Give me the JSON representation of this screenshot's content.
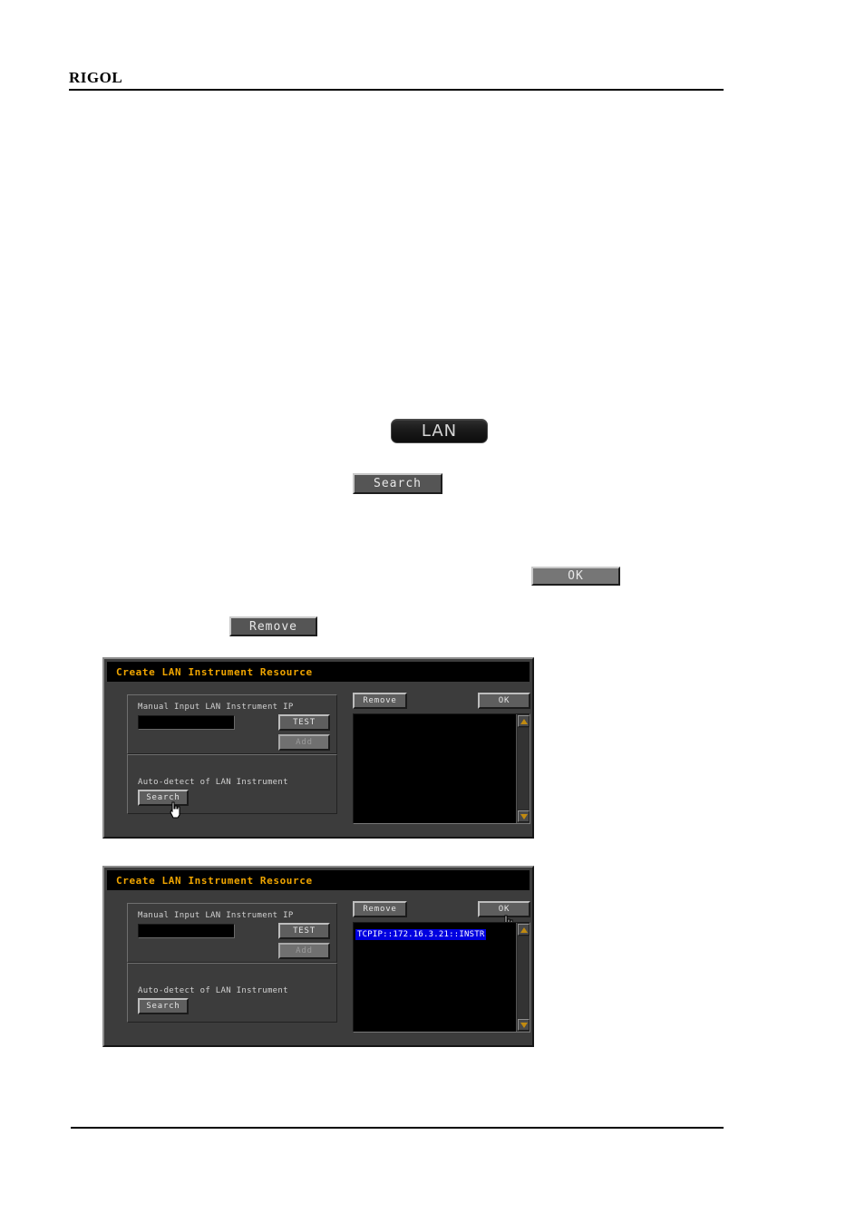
{
  "page": {
    "brand": "RIGOL"
  },
  "inline_buttons": {
    "lan": "LAN",
    "search": "Search",
    "ok": "OK",
    "remove": "Remove"
  },
  "dialogs": [
    {
      "title": "Create LAN Instrument Resource",
      "manual_group_label": "Manual Input LAN Instrument IP",
      "ip_value": "",
      "ip_placeholder": "",
      "test_label": "TEST",
      "add_label": "Add",
      "add_disabled": true,
      "auto_group_label": "Auto-detect of LAN Instrument",
      "search_label": "Search",
      "remove_label": "Remove",
      "ok_label": "OK",
      "list_items": [],
      "cursor_on": "search-button"
    },
    {
      "title": "Create LAN Instrument Resource",
      "manual_group_label": "Manual Input LAN Instrument IP",
      "ip_value": "",
      "ip_placeholder": "",
      "test_label": "TEST",
      "add_label": "Add",
      "add_disabled": true,
      "auto_group_label": "Auto-detect of LAN Instrument",
      "search_label": "Search",
      "remove_label": "Remove",
      "ok_label": "OK",
      "list_items": [
        "TCPIP::172.16.3.21::INSTR"
      ],
      "cursor_on": "ok-button"
    }
  ],
  "colors": {
    "title_text": "#f0a500",
    "dialog_bg": "#3c3c3c",
    "titlebar_bg": "#000000",
    "list_bg": "#000000",
    "selection_bg": "#0000e0",
    "scroll_arrow": "#c08a10",
    "softkey_text": "#d6d6d6"
  }
}
